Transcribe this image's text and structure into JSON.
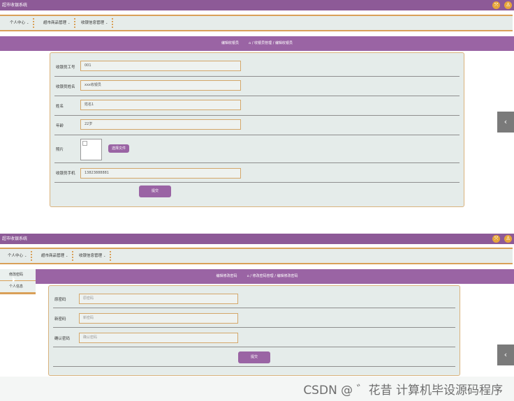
{
  "app_title": "超市收银系统",
  "nav": {
    "personal": "个人中心",
    "goods": "超市商品管理",
    "cashier": "收银信息管理"
  },
  "top_icons": [
    "fullscreen-icon",
    "user-icon"
  ],
  "screen1": {
    "crumb_title": "编辑收银员",
    "crumb_path": "/ 收银员管理 / 编辑收银员",
    "fields": {
      "id_label": "收银员工号",
      "id_value": "001",
      "account_label": "收银员姓名",
      "account_value": "xxx收银员",
      "name_label": "姓名",
      "name_value": "姓名1",
      "age_label": "年龄",
      "age_value": "22岁",
      "photo_label": "照片",
      "file_button": "选择文件",
      "phone_label": "收银员手机",
      "phone_value": "13823888881"
    },
    "submit": "提交"
  },
  "screen2": {
    "dropdown": [
      "修改密码",
      "个人信息"
    ],
    "crumb_title": "编辑修改密码",
    "crumb_path": "/ 修改密码管理 / 编辑修改密码",
    "fields": {
      "old_label": "原密码",
      "old_placeholder": "原密码",
      "new_label": "新密码",
      "new_placeholder": "新密码",
      "confirm_label": "确认密码",
      "confirm_placeholder": "确认密码"
    },
    "submit": "提交"
  },
  "watermark": "CSDN @ ゛花昔  计算机毕设源码程序",
  "colors": {
    "purple": "#8d5a97",
    "accent": "#d9a058",
    "panel": "#e5ecea"
  }
}
